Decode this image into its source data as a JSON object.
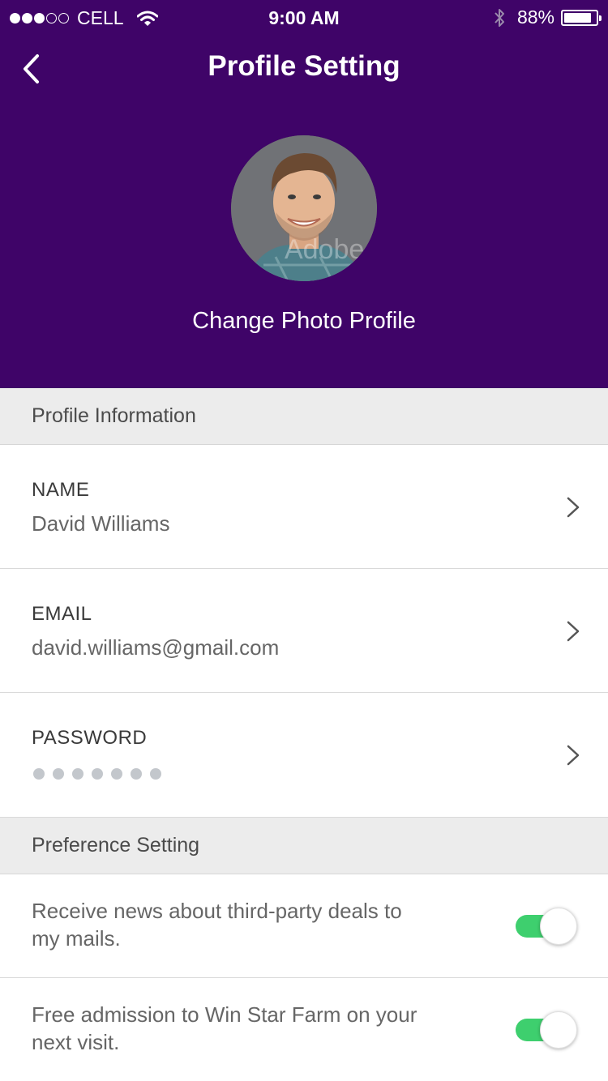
{
  "status_bar": {
    "carrier": "CELL",
    "time": "9:00 AM",
    "battery": "88%",
    "battery_level": 0.88,
    "signal_bars_filled": 3,
    "signal_bars_total": 5,
    "icons": [
      "wifi-icon",
      "bluetooth-icon",
      "battery-icon"
    ]
  },
  "nav": {
    "title": "Profile Setting",
    "back_icon": "chevron-left-icon"
  },
  "profile": {
    "change_photo_label": "Change Photo Profile",
    "avatar_watermark": "Adobe"
  },
  "sections": {
    "profile_information": "Profile Information",
    "preference_setting": "Preference Setting"
  },
  "fields": {
    "name": {
      "label": "NAME",
      "value": "David Williams"
    },
    "email": {
      "label": "EMAIL",
      "value": "david.williams@gmail.com"
    },
    "password": {
      "label": "PASSWORD",
      "masked_length": 7
    }
  },
  "preferences": [
    {
      "text": "Receive news about third-party deals to my mails.",
      "enabled": true
    },
    {
      "text": "Free admission to Win Star Farm on your next visit.",
      "enabled": true
    }
  ],
  "colors": {
    "header_bg": "#3f0468",
    "toggle_on": "#3ecf6e",
    "section_bg": "#ececec"
  }
}
